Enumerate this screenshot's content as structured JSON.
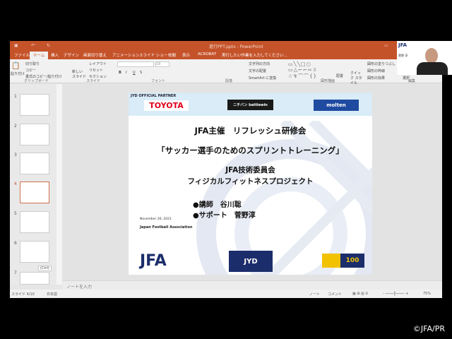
{
  "window": {
    "quick_access": [
      "save",
      "undo",
      "redo"
    ],
    "title": "進行PPT.pptx - PowerPoint"
  },
  "tabs": [
    "ファイル",
    "ホーム",
    "挿入",
    "デザイン",
    "画面切り替え",
    "アニメーション",
    "スライド ショー",
    "校閲",
    "表示",
    "ACROBAT"
  ],
  "tell_me": "実行したい作業を入力してください...",
  "ribbon": {
    "paste": "貼り付け",
    "cut": "切り取り",
    "copy": "コピー",
    "format_painter": "書式のコピー/貼り付け",
    "new_slide": "新しい スライド",
    "layout": "レイアウト",
    "reset": "リセット",
    "section": "セクション",
    "font_size": "18",
    "bold": "B",
    "italic": "I",
    "underline": "U",
    "shadow": "S",
    "text_direction": "文字列の方向",
    "align_text": "文字の配置",
    "smartart": "SmartArt に変換",
    "arrange": "配置",
    "quick_styles": "クイック スタイル",
    "shape_fill": "図形の塗りつぶし",
    "shape_outline": "図形の枠線",
    "shape_effects": "図形の効果",
    "select": "選択",
    "groups": [
      "クリップボード",
      "スライド",
      "フォント",
      "段落",
      "図形描画",
      "編集"
    ]
  },
  "thumbnails": {
    "numbers": [
      "1",
      "2",
      "3",
      "4",
      "5",
      "6",
      "7"
    ],
    "selected": "4",
    "paste_options": "(Ctrl)"
  },
  "slide": {
    "partner_label": "JYD OFFICIAL PARTNER",
    "sponsors": [
      "TOYOTA",
      "ニチバン battlewin",
      "molten"
    ],
    "title1": "JFA主催　リフレッシュ研修会",
    "title2": "「サッカー選手のためのスプリントトレーニング」",
    "org1": "JFA技術委員会",
    "org2": "フィジカルフィットネスプロジェクト",
    "lecturer": "●講師　谷川聡",
    "support": "●サポート　菅野淳",
    "date": "November 26, 2021",
    "assoc": "Japan Football Association",
    "logos": [
      "JFA",
      "JYD",
      "100"
    ]
  },
  "notes_placeholder": "ノートを入力",
  "status": {
    "slide": "スライド 4/10",
    "lang": "日本語",
    "notes": "ノート",
    "comments": "コメント",
    "zoom": "75%"
  },
  "webcam": {
    "logo": "JFA",
    "name": "菅野 淳"
  },
  "copyright": "©JFA/PR"
}
